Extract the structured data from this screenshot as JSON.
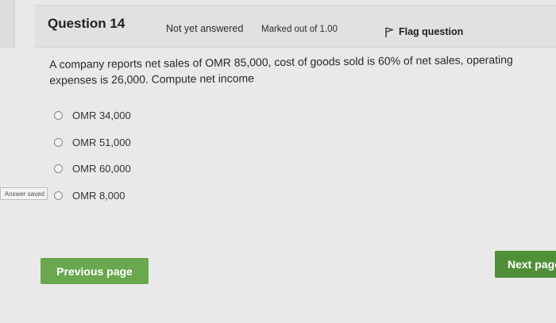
{
  "header": {
    "question_label": "Question 14",
    "status": "Not yet answered",
    "marked_out_of": "Marked out of 1.00",
    "flag_label": "Flag question"
  },
  "question": {
    "text": "A company reports net sales of OMR 85,000, cost of goods sold is 60% of net sales, operating expenses is 26,000. Compute net income"
  },
  "options": [
    {
      "label": "OMR 34,000",
      "selected": false
    },
    {
      "label": "OMR 51,000",
      "selected": false
    },
    {
      "label": "OMR 60,000",
      "selected": false
    },
    {
      "label": "OMR 8,000",
      "selected": false
    }
  ],
  "answer_saved": "Answer saved",
  "navigation": {
    "previous_label": "Previous page",
    "next_label": "Next page"
  },
  "colors": {
    "previous_button": "#6aa74f",
    "next_button": "#4f8f38",
    "info_bar": "#dfe1e3"
  },
  "icons": {
    "flag": "flag-icon",
    "radio": "radio-unchecked-icon"
  }
}
